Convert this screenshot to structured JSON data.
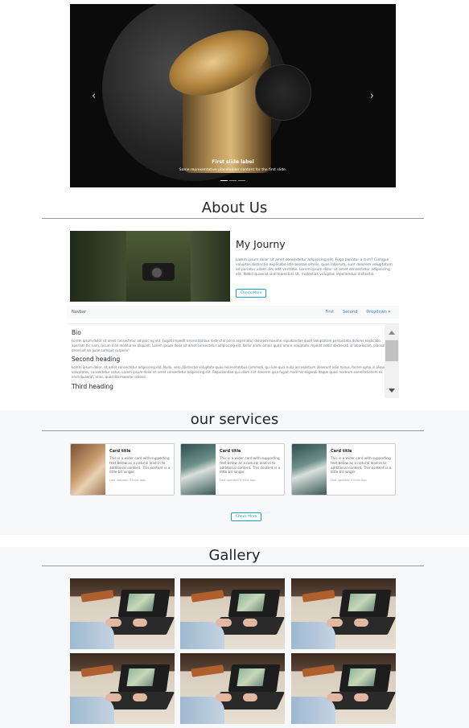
{
  "carousel": {
    "caption_title": "First slide label",
    "caption_text": "Some representative placeholder content for the first slide.",
    "prev_icon": "chevron-left-icon",
    "next_icon": "chevron-right-icon",
    "slide_count": 3,
    "active_slide": 1
  },
  "about": {
    "heading": "About Us",
    "title": "My Journy",
    "text": "Lorem ipsum dolor sit amet consectetur adipisicing elit. Fuga pariatur a cum? Cumque voluptas distinctio explicabo iste beatae omnis, quas laborum, sunt dolorem voluptatum ad pariatur ullam illo, odit veritatis. Lorem ipsum dolor sit amet consectetur adipisicing elit. Nobis quaerat sint molestiis! Ut, molestias voluptas repellendus distinctio.",
    "button": "Check More"
  },
  "navbar": {
    "brand": "Navbar",
    "links": [
      "First",
      "Second",
      "Dropdown ▾"
    ]
  },
  "scroll": {
    "h1": "Bio",
    "p1": "Lorem ipsum dolor sit amet consectetur adipisicing elit. Fugiat impedit necessitatibus distinctio porro aspernatur dolorem maxime repudiandae quod voluptatum perspiciatis dolores explicabo, aperiam hic nam, ipsum nihil mollitia ex aliquam. Lorem ipsum dolor sit amet consectetur adipisicing elit. Dolor animi omnis quasi omnis voluptate impedit nobis obcaecati id laboriosam, placeat deserunt ea quae cumque corporis!",
    "h2": "Second heading",
    "p2": "Lorem ipsum dolor, sit amet consectetur adipisicing elit. Nulla, vero. Distinctio voluptate quas necessitatibus commodi, qui iure quia nulla accusantium deserunt odio minus, facere optio in aliquid voluptates, consectetur natus. Lorem ipsum dolor sit amet consectetur adipisicing elit. Repudiandae qui ullam sint dolorem ipsa fugiat modi hic eligendi itaque quasi nostrum exercitationem ex enim quaerat, error, quod illo maxime ratione.",
    "h3": "Third heading"
  },
  "services": {
    "heading": "our services",
    "button": "Check More",
    "cards": [
      {
        "title": "Card title",
        "text": "This is a wider card with supporting text below as a natural lead-in to additional content. This content is a little bit longer.",
        "meta": "Last updated 3 mins ago"
      },
      {
        "title": "Card title",
        "text": "This is a wider card with supporting text below as a natural lead-in to additional content. This content is a little bit longer.",
        "meta": "Last updated 3 mins ago"
      },
      {
        "title": "Card title",
        "text": "This is a wider card with supporting text below as a natural lead-in to additional content. This content is a little bit longer.",
        "meta": "Last updated 3 mins ago"
      }
    ]
  },
  "gallery": {
    "heading": "Gallery",
    "image_count": 6
  },
  "colors": {
    "accent": "#17a2b8",
    "link": "#3b7ddd",
    "section_bg": "#f7f8fa"
  }
}
